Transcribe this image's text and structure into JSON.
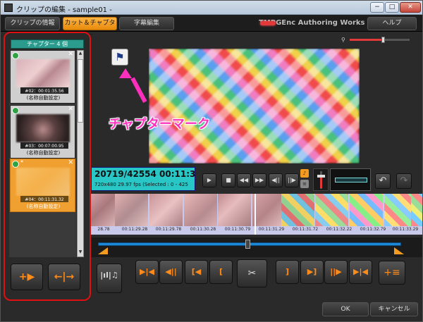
{
  "window": {
    "title": "クリップの編集 - sample01 -",
    "min": "−",
    "max": "□",
    "close": "✕"
  },
  "tabs": [
    {
      "label": "クリップの情報"
    },
    {
      "label": "カット＆チャプター"
    },
    {
      "label": "字幕編集"
    }
  ],
  "brand": "TMPGEnc Authoring Works 5",
  "help_label": "ヘルプ",
  "chapters": {
    "header": "チャプター 4 個",
    "items": [
      {
        "timecode": "#02：00:01:35.56",
        "name": "(名称自動設定)"
      },
      {
        "timecode": "#03：00:07:00.95",
        "name": "(名称自動設定)"
      },
      {
        "timecode": "#04：00:11:31.32",
        "name": "(名称自動設定)",
        "star": "*"
      }
    ],
    "add_icon": "+▶",
    "move_icon": "←|→"
  },
  "preview": {
    "flag_icon": "⚑",
    "annotation": "チャプターマーク"
  },
  "zoom": {
    "level": 0.55
  },
  "timecode": {
    "main": "20719/42554 00:11:3",
    "sub": "720x480 29.97 fps (Selected : 0 - 425"
  },
  "transport": [
    "▶",
    "■",
    "◀◀",
    "▶▶",
    "◀||",
    "||▶"
  ],
  "audio": {
    "a1": "♪",
    "a2": "≡",
    "volume": 0.7
  },
  "undo_icon": "↶",
  "redo_icon": "↷",
  "filmstrip_times": [
    "28.78",
    "00:11:29.28",
    "00:11:29.78",
    "00:11:30.28",
    "00:11:30.79",
    "00:11:31.29",
    "00:11:31.72",
    "00:11:32.22",
    "00:11:32.79",
    "00:11:33.29"
  ],
  "edit_buttons": {
    "wave": "|ıl|♫",
    "b1": "▶|◀",
    "b2": "◀||",
    "b3": "[◀",
    "b4": "[",
    "cut": "✂",
    "b6": "]",
    "b7": "▶]",
    "b8": "||▶",
    "b9": "▶|◀",
    "list": "+≡"
  },
  "ok_label": "OK",
  "cancel_label": "キャンセル",
  "colors": {
    "accent": "#f39a21",
    "highlight": "#e01010",
    "annotation": "#ff2fbd",
    "timecode_bg": "#29c6c6"
  }
}
